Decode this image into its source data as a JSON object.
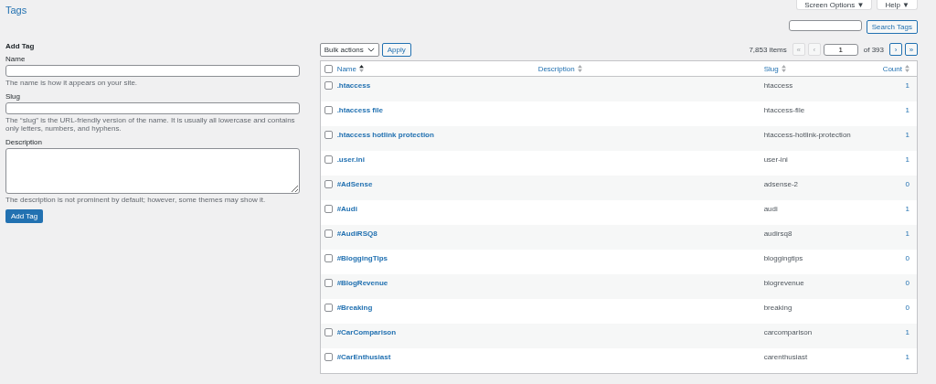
{
  "screen_meta": [
    {
      "label": "Screen Options",
      "caret": "▼"
    },
    {
      "label": "Help",
      "caret": "▼"
    }
  ],
  "title": "Tags",
  "search": {
    "button": "Search Tags"
  },
  "form": {
    "heading": "Add Tag",
    "fields": [
      {
        "kind": "input",
        "label": "Name",
        "hint": "The name is how it appears on your site."
      },
      {
        "kind": "input",
        "label": "Slug",
        "hint": "The “slug” is the URL-friendly version of the name. It is usually all lowercase and contains only letters, numbers, and hyphens."
      },
      {
        "kind": "textarea",
        "label": "Description",
        "hint": "The description is not prominent by default; however, some themes may show it."
      }
    ],
    "submit": "Add Tag"
  },
  "bulk": {
    "select": "Bulk actions",
    "apply": "Apply"
  },
  "pagination": {
    "items": "7,853 items",
    "page": "1",
    "of": "of 393",
    "buttons": [
      {
        "label": "«",
        "disabled": true
      },
      {
        "label": "‹",
        "disabled": true
      }
    ],
    "next_buttons": [
      {
        "label": "›",
        "disabled": false
      },
      {
        "label": "»",
        "disabled": false
      }
    ]
  },
  "table": {
    "select_all_checked": false,
    "columns": [
      {
        "label": "Name",
        "sorted": true
      },
      {
        "label": "Description",
        "sorted": false
      },
      {
        "label": "Slug",
        "sorted": false
      },
      {
        "label": "Count",
        "sorted": false
      }
    ],
    "rows": [
      {
        "name": ".htaccess",
        "slug": "htaccess",
        "count": "1",
        "checked": false
      },
      {
        "name": ".htaccess file",
        "slug": "htaccess-file",
        "count": "1",
        "checked": false
      },
      {
        "name": ".htaccess hotlink protection",
        "slug": "htaccess-hotlink-protection",
        "count": "1",
        "checked": false
      },
      {
        "name": ".user.ini",
        "slug": "user-ini",
        "count": "1",
        "checked": false
      },
      {
        "name": "#AdSense",
        "slug": "adsense-2",
        "count": "0",
        "checked": false
      },
      {
        "name": "#Audi",
        "slug": "audi",
        "count": "1",
        "checked": false
      },
      {
        "name": "#AudiRSQ8",
        "slug": "audirsq8",
        "count": "1",
        "checked": false
      },
      {
        "name": "#BloggingTips",
        "slug": "bloggingtips",
        "count": "0",
        "checked": false
      },
      {
        "name": "#BlogRevenue",
        "slug": "blogrevenue",
        "count": "0",
        "checked": false
      },
      {
        "name": "#Breaking",
        "slug": "breaking",
        "count": "0",
        "checked": false
      },
      {
        "name": "#CarComparison",
        "slug": "carcomparison",
        "count": "1",
        "checked": false
      },
      {
        "name": "#CarEnthusiast",
        "slug": "carenthusiast",
        "count": "1",
        "checked": false
      }
    ]
  }
}
